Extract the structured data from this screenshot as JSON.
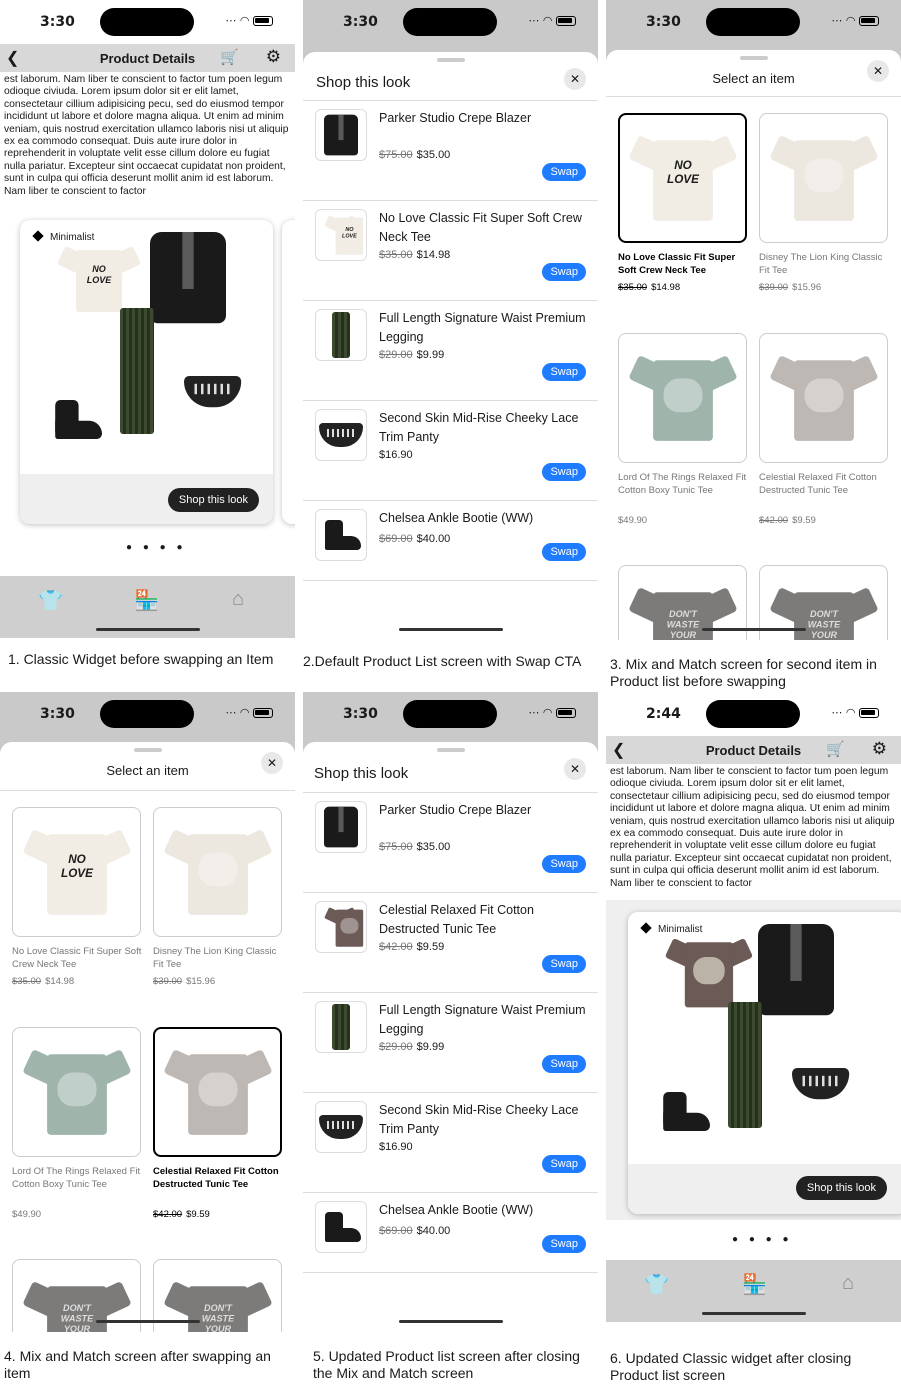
{
  "status": {
    "time_a": "3:30",
    "time_b": "2:44"
  },
  "product_details": {
    "title": "Product Details",
    "lorem": "est laborum. Nam liber te conscient to factor tum poen legum odioque civiuda. Lorem ipsum dolor sit er elit lamet, consectetaur cillium adipisicing pecu, sed do eiusmod tempor incididunt ut labore et dolore magna aliqua. Ut enim ad minim veniam, quis nostrud exercitation ullamco laboris nisi ut aliquip ex ea commodo consequat. Duis aute irure dolor in reprehenderit in voluptate velit esse cillum dolore eu fugiat nulla pariatur. Excepteur sint occaecat cupidatat non proident, sunt in culpa qui officia deserunt mollit anim id est laborum. Nam liber te conscient to factor",
    "tag": "Minimalist",
    "shop_button": "Shop this look",
    "dots": "● ● ● ●"
  },
  "shop_sheet": {
    "title": "Shop this look",
    "close": "✕",
    "swap": "Swap",
    "items_before": [
      {
        "name": "Parker Studio Crepe Blazer",
        "old": "$75.00",
        "new": "$35.00",
        "kind": "blazer"
      },
      {
        "name": "No Love Classic Fit Super Soft Crew Neck Tee",
        "old": "$35.00",
        "new": "$14.98",
        "kind": "tee-white"
      },
      {
        "name": "Full Length Signature Waist Premium Legging",
        "old": "$29.00",
        "new": "$9.99",
        "kind": "legging"
      },
      {
        "name": "Second Skin Mid-Rise Cheeky Lace Trim Panty",
        "old": "",
        "new": "$16.90",
        "kind": "panty"
      },
      {
        "name": "Chelsea Ankle Bootie (WW)",
        "old": "$69.00",
        "new": "$40.00",
        "kind": "boot"
      }
    ],
    "items_after": [
      {
        "name": "Parker Studio Crepe Blazer",
        "old": "$75.00",
        "new": "$35.00",
        "kind": "blazer"
      },
      {
        "name": "Celestial Relaxed Fit Cotton Destructed Tunic Tee",
        "old": "$42.00",
        "new": "$9.59",
        "kind": "tee-brown"
      },
      {
        "name": "Full Length Signature Waist Premium Legging",
        "old": "$29.00",
        "new": "$9.99",
        "kind": "legging"
      },
      {
        "name": "Second Skin Mid-Rise Cheeky Lace Trim Panty",
        "old": "",
        "new": "$16.90",
        "kind": "panty"
      },
      {
        "name": "Chelsea Ankle Bootie (WW)",
        "old": "$69.00",
        "new": "$40.00",
        "kind": "boot"
      }
    ]
  },
  "select_sheet": {
    "title": "Select an item",
    "close": "✕",
    "items": [
      {
        "name": "No Love Classic Fit Super Soft Crew Neck Tee",
        "old": "$35.00",
        "new": "$14.98",
        "kind": "tee-white"
      },
      {
        "name": "Disney The Lion King Classic Fit Tee",
        "old": "$39.00",
        "new": "$15.96",
        "kind": "tee-cream"
      },
      {
        "name": "Lord Of The Rings Relaxed Fit Cotton Boxy Tunic Tee",
        "old": "",
        "new": "$49.90",
        "kind": "tee-sage"
      },
      {
        "name": "Celestial Relaxed Fit Cotton Destructed Tunic Tee",
        "old": "$42.00",
        "new": "$9.59",
        "kind": "tee-grayish"
      },
      {
        "name": "",
        "old": "",
        "new": "",
        "kind": "tee-gray"
      },
      {
        "name": "",
        "old": "",
        "new": "",
        "kind": "tee-gray"
      }
    ],
    "tee_text_nolove": "NO LOVE",
    "tee_text_dontwaste": "DON'T WASTE YOUR ENERGY"
  },
  "captions": {
    "c1": "1. Classic Widget before swapping an Item",
    "c2": "2.Default Product List screen with Swap CTA",
    "c3": "3. Mix and Match screen for second item in Product list before swapping",
    "c4": "4. Mix and Match screen after swapping an item",
    "c5": "5. Updated Product list screen after closing the Mix and Match screen",
    "c6": "6. Updated Classic widget after closing Product list screen"
  },
  "colors": {
    "accent": "#1f7bff",
    "tab_active": "#b03a1a",
    "tab_inactive": "#8a8a8a"
  }
}
